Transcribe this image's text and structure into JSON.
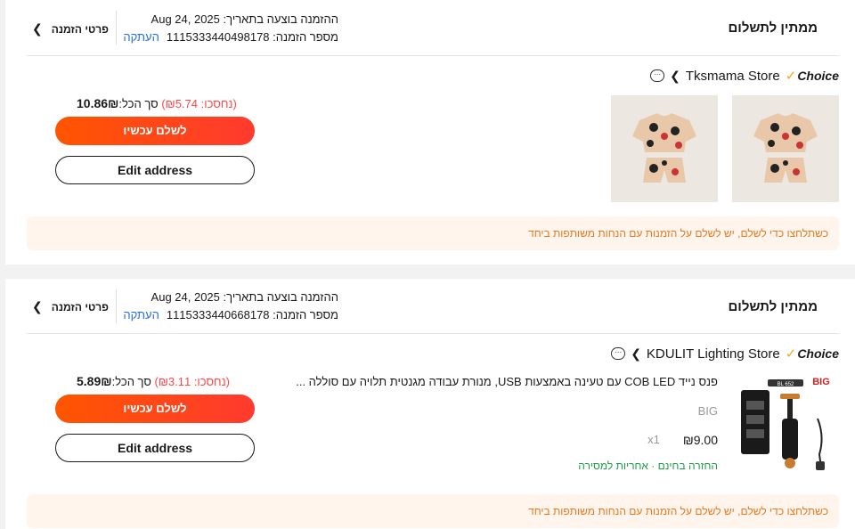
{
  "orders": [
    {
      "status": "ממתין לתשלום",
      "date_label": "ההזמנה בוצעה בתאריך:",
      "date": "Aug 24, 2025",
      "order_no_label": "מספר הזמנה:",
      "order_no": "1115333440498178",
      "copy_label": "העתקה",
      "details_label": "פרטי הזמנה",
      "choice_label": "Choice",
      "store_name": "Tksmama Store",
      "saved_text": "(נחסכו: ₪5.74)",
      "total_label": "סך הכל:",
      "total_amount": "10.86₪",
      "pay_label": "לשלם עכשיו",
      "edit_label": "Edit address",
      "notice": "כשתלחצו כדי לשלם, יש לשלם על הזמנות עם הנחות משותפות ביחד"
    },
    {
      "status": "ממתין לתשלום",
      "date_label": "ההזמנה בוצעה בתאריך:",
      "date": "Aug 24, 2025",
      "order_no_label": "מספר הזמנה:",
      "order_no": "1115333440668178",
      "copy_label": "העתקה",
      "details_label": "פרטי הזמנה",
      "choice_label": "Choice",
      "store_name": "KDULIT Lighting Store",
      "saved_text": "(נחסכו: ₪3.11)",
      "total_label": "סך הכל:",
      "total_amount": "5.89₪",
      "pay_label": "לשלם עכשיו",
      "edit_label": "Edit address",
      "notice": "כשתלחצו כדי לשלם, יש לשלם על הזמנות עם הנחות משותפות ביחד",
      "product": {
        "title": "פנס נייד COB LED עם טעינה באמצעות USB, מנורת עבודה מגנטית תלויה עם סוללה ...",
        "variant": "BIG",
        "price": "₪9.00",
        "qty": "x1",
        "features": "החזרה בחינם · אחריות למסירה",
        "image_badge": "BIG",
        "image_model": "BL 652"
      }
    }
  ],
  "icons": {
    "chevron_left": "chevron-left-icon",
    "chat": "chat-icon",
    "choice_check": "check-icon"
  },
  "colors": {
    "accent": "#ff4a1c",
    "notice_bg": "#fff5ec",
    "notice_text": "#e8781f",
    "link": "#2b6fd6",
    "green": "#1e9c4a"
  }
}
